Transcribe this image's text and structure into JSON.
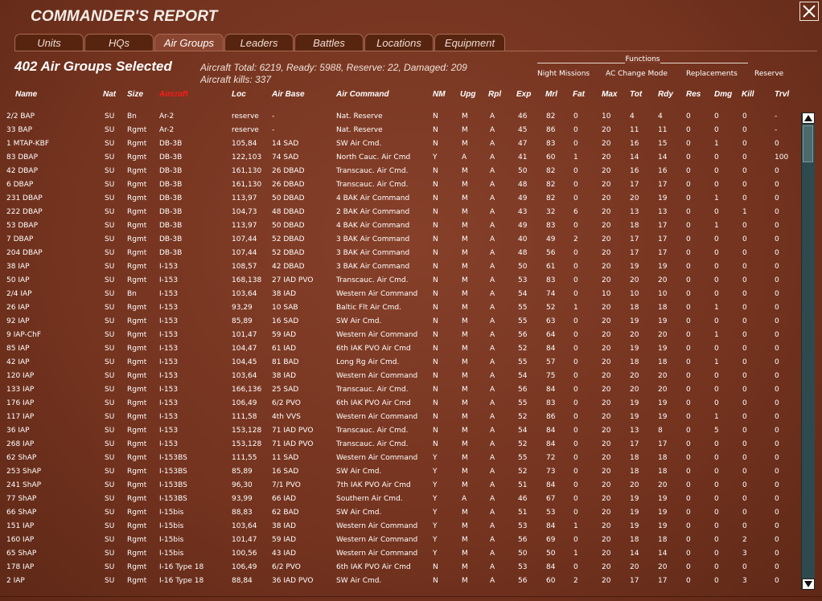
{
  "title": "COMMANDER'S REPORT",
  "tabs": [
    {
      "label": "Units",
      "left": 0,
      "width": 86
    },
    {
      "label": "HQs",
      "left": 0,
      "width": 86
    },
    {
      "label": "Air Groups",
      "left": 0,
      "width": 86,
      "active": true
    },
    {
      "label": "Leaders",
      "left": 0,
      "width": 86
    },
    {
      "label": "Battles",
      "left": 0,
      "width": 86
    },
    {
      "label": "Locations",
      "left": 0,
      "width": 86
    },
    {
      "label": "Equipment",
      "left": 0,
      "width": 86
    }
  ],
  "selection": {
    "count_text": "402 Air Groups Selected",
    "summary_line1": "Aircraft Total: 6219, Ready: 5988, Reserve: 22, Damaged: 209",
    "summary_line2": "Aircraft kills: 337"
  },
  "functions": {
    "label": "Functions",
    "buttons": [
      "Night Missions",
      "AC Change Mode",
      "Replacements",
      "Reserve"
    ]
  },
  "columns": [
    "Name",
    "Nat",
    "Size",
    "Aircraft",
    "Loc",
    "Air Base",
    "Air Command",
    "NM",
    "Upg",
    "Rpl",
    "Exp",
    "Mrl",
    "Fat",
    "Max",
    "Tot",
    "Rdy",
    "Res",
    "Dmg",
    "Kill",
    "Trvl"
  ],
  "sorted_column": "Aircraft",
  "rows": [
    [
      "2/2 BAP",
      "SU",
      "Bn",
      "Ar-2",
      "reserve",
      "-",
      "Nat. Reserve",
      "N",
      "M",
      "A",
      "46",
      "82",
      "0",
      "10",
      "4",
      "4",
      "0",
      "0",
      "0",
      "-"
    ],
    [
      "33 BAP",
      "SU",
      "Rgmt",
      "Ar-2",
      "reserve",
      "-",
      "Nat. Reserve",
      "N",
      "M",
      "A",
      "45",
      "86",
      "0",
      "20",
      "11",
      "11",
      "0",
      "0",
      "0",
      "-"
    ],
    [
      "1 MTAP-KBF",
      "SU",
      "Rgmt",
      "DB-3B",
      "105,84",
      "14 SAD",
      "SW Air Cmd.",
      "N",
      "M",
      "A",
      "47",
      "83",
      "0",
      "20",
      "16",
      "15",
      "0",
      "1",
      "0",
      "0"
    ],
    [
      "83 DBAP",
      "SU",
      "Rgmt",
      "DB-3B",
      "122,103",
      "74 SAD",
      "North Cauc. Air Cmd",
      "Y",
      "A",
      "A",
      "41",
      "60",
      "1",
      "20",
      "14",
      "14",
      "0",
      "0",
      "0",
      "100"
    ],
    [
      "42 DBAP",
      "SU",
      "Rgmt",
      "DB-3B",
      "161,130",
      "26 DBAD",
      "Transcauc. Air Cmd.",
      "N",
      "M",
      "A",
      "50",
      "82",
      "0",
      "20",
      "16",
      "16",
      "0",
      "0",
      "0",
      "0"
    ],
    [
      "6 DBAP",
      "SU",
      "Rgmt",
      "DB-3B",
      "161,130",
      "26 DBAD",
      "Transcauc. Air Cmd.",
      "N",
      "M",
      "A",
      "48",
      "82",
      "0",
      "20",
      "17",
      "17",
      "0",
      "0",
      "0",
      "0"
    ],
    [
      "231 DBAP",
      "SU",
      "Rgmt",
      "DB-3B",
      "113,97",
      "50 DBAD",
      "4 BAK Air Command",
      "N",
      "M",
      "A",
      "49",
      "82",
      "0",
      "20",
      "20",
      "19",
      "0",
      "1",
      "0",
      "0"
    ],
    [
      "222 DBAP",
      "SU",
      "Rgmt",
      "DB-3B",
      "104,73",
      "48 DBAD",
      "2 BAK Air Command",
      "N",
      "M",
      "A",
      "43",
      "32",
      "6",
      "20",
      "13",
      "13",
      "0",
      "0",
      "1",
      "0"
    ],
    [
      "53 DBAP",
      "SU",
      "Rgmt",
      "DB-3B",
      "113,97",
      "50 DBAD",
      "4 BAK Air Command",
      "N",
      "M",
      "A",
      "49",
      "83",
      "0",
      "20",
      "18",
      "17",
      "0",
      "1",
      "0",
      "0"
    ],
    [
      "7 DBAP",
      "SU",
      "Rgmt",
      "DB-3B",
      "107,44",
      "52 DBAD",
      "3 BAK Air Command",
      "N",
      "M",
      "A",
      "40",
      "49",
      "2",
      "20",
      "17",
      "17",
      "0",
      "0",
      "0",
      "0"
    ],
    [
      "204 DBAP",
      "SU",
      "Rgmt",
      "DB-3B",
      "107,44",
      "52 DBAD",
      "3 BAK Air Command",
      "N",
      "M",
      "A",
      "48",
      "56",
      "0",
      "20",
      "17",
      "17",
      "0",
      "0",
      "0",
      "0"
    ],
    [
      "38 IAP",
      "SU",
      "Rgmt",
      "I-153",
      "108,57",
      "42 DBAD",
      "3 BAK Air Command",
      "N",
      "M",
      "A",
      "50",
      "61",
      "0",
      "20",
      "19",
      "19",
      "0",
      "0",
      "0",
      "0"
    ],
    [
      "50 IAP",
      "SU",
      "Rgmt",
      "I-153",
      "168,138",
      "27 IAD PVO",
      "Transcauc. Air Cmd.",
      "N",
      "M",
      "A",
      "53",
      "83",
      "0",
      "20",
      "20",
      "20",
      "0",
      "0",
      "0",
      "0"
    ],
    [
      "2/4 IAP",
      "SU",
      "Bn",
      "I-153",
      "103,64",
      "38 IAD",
      "Western Air Command",
      "N",
      "M",
      "A",
      "54",
      "74",
      "0",
      "10",
      "10",
      "10",
      "0",
      "0",
      "0",
      "0"
    ],
    [
      "26 IAP",
      "SU",
      "Rgmt",
      "I-153",
      "93,29",
      "10 SAB",
      "Baltic Flt Air Cmd.",
      "N",
      "M",
      "A",
      "55",
      "52",
      "1",
      "20",
      "18",
      "18",
      "0",
      "1",
      "0",
      "0"
    ],
    [
      "92 IAP",
      "SU",
      "Rgmt",
      "I-153",
      "85,89",
      "16 SAD",
      "SW Air Cmd.",
      "N",
      "M",
      "A",
      "55",
      "63",
      "0",
      "20",
      "19",
      "19",
      "0",
      "0",
      "0",
      "0"
    ],
    [
      "9 IAP-ChF",
      "SU",
      "Rgmt",
      "I-153",
      "101,47",
      "59 IAD",
      "Western Air Command",
      "N",
      "M",
      "A",
      "56",
      "64",
      "0",
      "20",
      "20",
      "20",
      "0",
      "1",
      "0",
      "0"
    ],
    [
      "85 IAP",
      "SU",
      "Rgmt",
      "I-153",
      "104,47",
      "61 IAD",
      "6th IAK PVO Air Cmd",
      "N",
      "M",
      "A",
      "52",
      "84",
      "0",
      "20",
      "19",
      "19",
      "0",
      "0",
      "0",
      "0"
    ],
    [
      "42 IAP",
      "SU",
      "Rgmt",
      "I-153",
      "104,45",
      "81 BAD",
      "Long Rg Air Cmd.",
      "N",
      "M",
      "A",
      "55",
      "57",
      "0",
      "20",
      "18",
      "18",
      "0",
      "1",
      "0",
      "0"
    ],
    [
      "120 IAP",
      "SU",
      "Rgmt",
      "I-153",
      "103,64",
      "38 IAD",
      "Western Air Command",
      "N",
      "M",
      "A",
      "54",
      "75",
      "0",
      "20",
      "20",
      "20",
      "0",
      "0",
      "0",
      "0"
    ],
    [
      "133 IAP",
      "SU",
      "Rgmt",
      "I-153",
      "166,136",
      "25 SAD",
      "Transcauc. Air Cmd.",
      "N",
      "M",
      "A",
      "56",
      "84",
      "0",
      "20",
      "20",
      "20",
      "0",
      "0",
      "0",
      "0"
    ],
    [
      "176 IAP",
      "SU",
      "Rgmt",
      "I-153",
      "106,49",
      "6/2 PVO",
      "6th IAK PVO Air Cmd",
      "N",
      "M",
      "A",
      "55",
      "83",
      "0",
      "20",
      "19",
      "19",
      "0",
      "0",
      "0",
      "0"
    ],
    [
      "117 IAP",
      "SU",
      "Rgmt",
      "I-153",
      "111,58",
      "4th VVS",
      "Western Air Command",
      "N",
      "M",
      "A",
      "52",
      "86",
      "0",
      "20",
      "19",
      "19",
      "0",
      "1",
      "0",
      "0"
    ],
    [
      "36 IAP",
      "SU",
      "Rgmt",
      "I-153",
      "153,128",
      "71 IAD PVO",
      "Transcauc. Air Cmd.",
      "N",
      "M",
      "A",
      "54",
      "84",
      "0",
      "20",
      "13",
      "8",
      "0",
      "5",
      "0",
      "0"
    ],
    [
      "268 IAP",
      "SU",
      "Rgmt",
      "I-153",
      "153,128",
      "71 IAD PVO",
      "Transcauc. Air Cmd.",
      "N",
      "M",
      "A",
      "52",
      "84",
      "0",
      "20",
      "17",
      "17",
      "0",
      "0",
      "0",
      "0"
    ],
    [
      "62 ShAP",
      "SU",
      "Rgmt",
      "I-153BS",
      "111,55",
      "11 SAD",
      "Western Air Command",
      "Y",
      "M",
      "A",
      "55",
      "72",
      "0",
      "20",
      "18",
      "18",
      "0",
      "0",
      "0",
      "0"
    ],
    [
      "253 ShAP",
      "SU",
      "Rgmt",
      "I-153BS",
      "85,89",
      "16 SAD",
      "SW Air Cmd.",
      "Y",
      "M",
      "A",
      "52",
      "73",
      "0",
      "20",
      "18",
      "18",
      "0",
      "0",
      "0",
      "0"
    ],
    [
      "241 ShAP",
      "SU",
      "Rgmt",
      "I-153BS",
      "96,30",
      "7/1 PVO",
      "7th IAK PVO Air Cmd",
      "Y",
      "M",
      "A",
      "51",
      "84",
      "0",
      "20",
      "20",
      "20",
      "0",
      "0",
      "0",
      "0"
    ],
    [
      "77 ShAP",
      "SU",
      "Rgmt",
      "I-153BS",
      "93,99",
      "66 IAD",
      "Southern Air Cmd.",
      "Y",
      "A",
      "A",
      "46",
      "67",
      "0",
      "20",
      "19",
      "19",
      "0",
      "0",
      "0",
      "0"
    ],
    [
      "66 ShAP",
      "SU",
      "Rgmt",
      "I-15bis",
      "88,83",
      "62 BAD",
      "SW Air Cmd.",
      "Y",
      "M",
      "A",
      "51",
      "53",
      "0",
      "20",
      "19",
      "19",
      "0",
      "0",
      "0",
      "0"
    ],
    [
      "151 IAP",
      "SU",
      "Rgmt",
      "I-15bis",
      "103,64",
      "38 IAD",
      "Western Air Command",
      "Y",
      "M",
      "A",
      "53",
      "84",
      "1",
      "20",
      "19",
      "19",
      "0",
      "0",
      "0",
      "0"
    ],
    [
      "160 IAP",
      "SU",
      "Rgmt",
      "I-15bis",
      "101,47",
      "59 IAD",
      "Western Air Command",
      "Y",
      "M",
      "A",
      "56",
      "69",
      "0",
      "20",
      "18",
      "18",
      "0",
      "0",
      "2",
      "0"
    ],
    [
      "65 ShAP",
      "SU",
      "Rgmt",
      "I-15bis",
      "100,56",
      "43 IAD",
      "Western Air Command",
      "Y",
      "M",
      "A",
      "50",
      "50",
      "1",
      "20",
      "14",
      "14",
      "0",
      "0",
      "3",
      "0"
    ],
    [
      "178 IAP",
      "SU",
      "Rgmt",
      "I-16 Type 18",
      "106,49",
      "6/2 PVO",
      "6th IAK PVO Air Cmd",
      "N",
      "M",
      "A",
      "53",
      "84",
      "0",
      "20",
      "20",
      "20",
      "0",
      "0",
      "0",
      "0"
    ],
    [
      "2 IAP",
      "SU",
      "Rgmt",
      "I-16 Type 18",
      "88,84",
      "36 IAD PVO",
      "SW Air Cmd.",
      "N",
      "M",
      "A",
      "56",
      "60",
      "2",
      "20",
      "17",
      "17",
      "0",
      "0",
      "3",
      "0"
    ]
  ]
}
